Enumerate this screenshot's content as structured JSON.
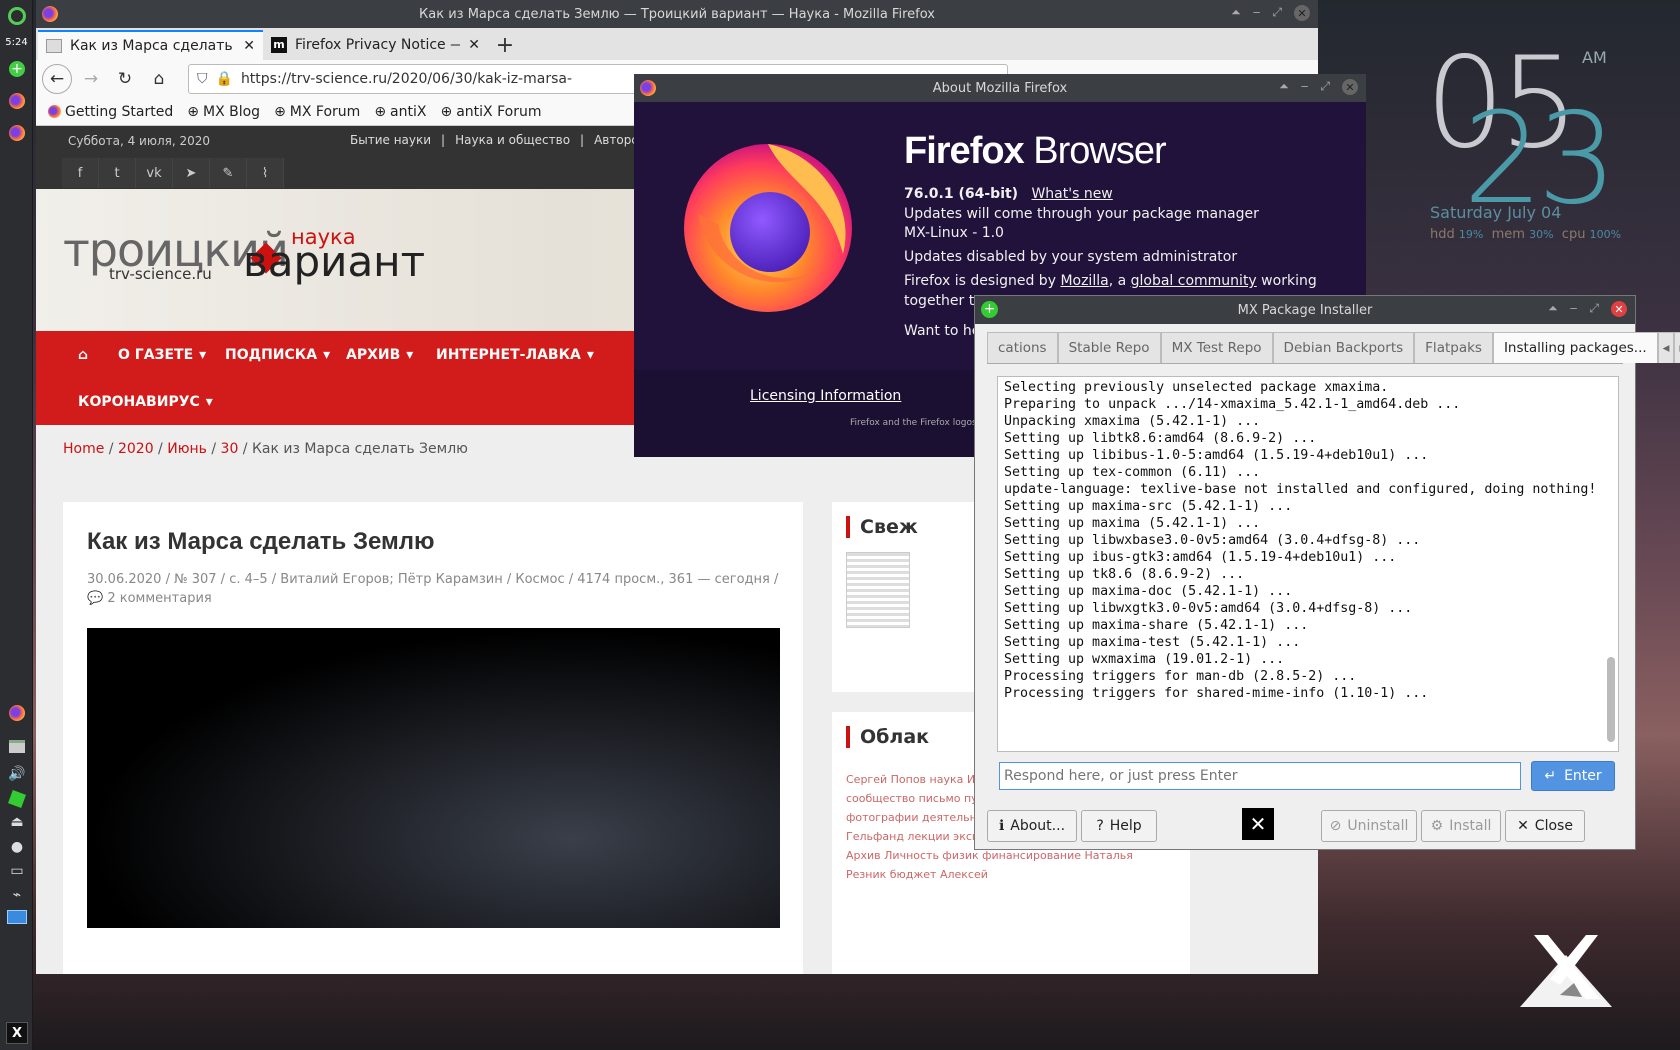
{
  "panel": {
    "time": "5:24"
  },
  "desktop_clock": {
    "hour": "05",
    "minute": "23",
    "ampm": "AM",
    "date": "Saturday   July 04",
    "hdd_label": "hdd",
    "hdd": "19%",
    "mem_label": "mem",
    "mem": "30%",
    "cpu_label": "cpu",
    "cpu": "100%"
  },
  "firefox": {
    "title": "Как из Марса сделать Землю — Троицкий вариант — Наука - Mozilla Firefox",
    "tabs": [
      {
        "label": "Как из Марса сделать Зе"
      },
      {
        "label": "Firefox Privacy Notice — "
      }
    ],
    "url": "https://trv-science.ru/2020/06/30/kak-iz-marsa-",
    "bookmarks": [
      "Getting Started",
      "MX Blog",
      "MX Forum",
      "antiX",
      "antiX Forum"
    ]
  },
  "site": {
    "date": "Суббота, 4 июля, 2020",
    "topnav": [
      "Бытие науки",
      "|",
      "Наука и общество",
      "|",
      "Авторские"
    ],
    "logo_main": "троицкий",
    "logo_url": "trv-science.ru",
    "logo_small": "наука",
    "logo_sub": "вариант",
    "menu": [
      "О ГАЗЕТЕ",
      "ПОДПИСКА",
      "АРХИВ",
      "ИНТЕРНЕТ-ЛАВКА",
      "КОРОНАВИРУС"
    ],
    "crumbs": {
      "home": "Home",
      "year": "2020",
      "month": "Июнь",
      "day": "30",
      "current": "Как из Марса сделать Землю"
    },
    "article_title": "Как из Марса сделать Землю",
    "meta": "30.06.2020 / № 307 / с. 4–5 / Виталий Егоров; Пётр Карамзин / Космос / 4174 просм., 361 — сегодня /",
    "comments": "2 комментария",
    "side1_title": "Свеж",
    "side2_title": "Облак",
    "tags": "Сергей Попов наука Ирина Левонтина научное сообщество письмо публикация Иван Экономов книга фотографии деятельность СМИ Россия отзыв Михаил Гельфанд лекции эксперимент ФАНО Лев Клейн РАН Архив Личность физик финансирование Наталья Резник бюджет Алексей"
  },
  "about": {
    "title": "About Mozilla Firefox",
    "brand_bold": "Firefox",
    "brand": " Browser",
    "version": "76.0.1 (64-bit)",
    "whats_new": "What's new",
    "l1": "Updates will come through your package manager",
    "l2": "MX-Linux - 1.0",
    "l3": "Updates disabled by your system administrator",
    "l4a": "Firefox is designed by ",
    "l4b": "Mozilla",
    "l4c": ", a ",
    "l4d": "global community",
    "l4e": " working",
    "l5": "together to",
    "l6": "Want to he",
    "licensing": "Licensing Information",
    "logos_note": "Firefox and the Firefox logos"
  },
  "mxpi": {
    "title": "MX Package Installer",
    "tabs": [
      "cations",
      "Stable Repo",
      "MX Test Repo",
      "Debian Backports",
      "Flatpaks",
      "Installing packages..."
    ],
    "console": "Selecting previously unselected package xmaxima.\nPreparing to unpack .../14-xmaxima_5.42.1-1_amd64.deb ...\nUnpacking xmaxima (5.42.1-1) ...\nSetting up libtk8.6:amd64 (8.6.9-2) ...\nSetting up libibus-1.0-5:amd64 (1.5.19-4+deb10u1) ...\nSetting up tex-common (6.11) ...\nupdate-language: texlive-base not installed and configured, doing nothing!\nSetting up maxima-src (5.42.1-1) ...\nSetting up maxima (5.42.1-1) ...\nSetting up libwxbase3.0-0v5:amd64 (3.0.4+dfsg-8) ...\nSetting up ibus-gtk3:amd64 (1.5.19-4+deb10u1) ...\nSetting up tk8.6 (8.6.9-2) ...\nSetting up maxima-doc (5.42.1-1) ...\nSetting up libwxgtk3.0-0v5:amd64 (3.0.4+dfsg-8) ...\nSetting up maxima-share (5.42.1-1) ...\nSetting up maxima-test (5.42.1-1) ...\nSetting up wxmaxima (19.01.2-1) ...\nProcessing triggers for man-db (2.8.5-2) ...\nProcessing triggers for shared-mime-info (1.10-1) ...",
    "respond_placeholder": "Respond here, or just press Enter",
    "enter": "Enter",
    "about": "About...",
    "help": "Help",
    "uninstall": "Uninstall",
    "install": "Install",
    "close": "Close"
  }
}
